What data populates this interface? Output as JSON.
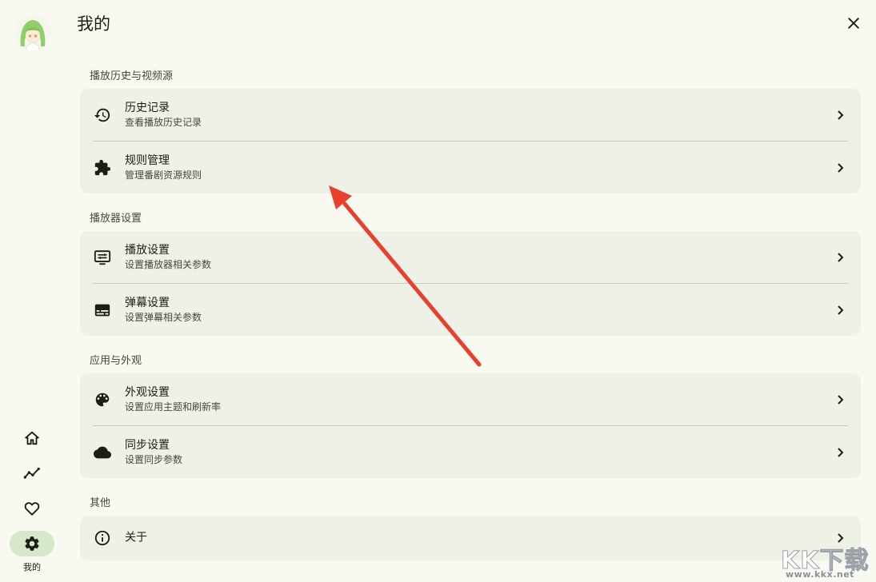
{
  "page_title": "我的",
  "nav": {
    "items": [
      {
        "icon": "home-icon"
      },
      {
        "icon": "trending-icon"
      },
      {
        "icon": "heart-icon"
      },
      {
        "icon": "gear-icon",
        "label": "我的",
        "active": true
      }
    ]
  },
  "sections": [
    {
      "title": "播放历史与视频源",
      "items": [
        {
          "title": "历史记录",
          "subtitle": "查看播放历史记录",
          "icon": "history-icon"
        },
        {
          "title": "规则管理",
          "subtitle": "管理番剧资源规则",
          "icon": "puzzle-icon"
        }
      ]
    },
    {
      "title": "播放器设置",
      "items": [
        {
          "title": "播放设置",
          "subtitle": "设置播放器相关参数",
          "icon": "monitor-settings-icon"
        },
        {
          "title": "弹幕设置",
          "subtitle": "设置弹幕相关参数",
          "icon": "subtitles-icon"
        }
      ]
    },
    {
      "title": "应用与外观",
      "items": [
        {
          "title": "外观设置",
          "subtitle": "设置应用主题和刷新率",
          "icon": "palette-icon"
        },
        {
          "title": "同步设置",
          "subtitle": "设置同步参数",
          "icon": "cloud-icon"
        }
      ]
    },
    {
      "title": "其他",
      "items": [
        {
          "title": "关于",
          "icon": "info-icon"
        }
      ]
    }
  ],
  "watermark": {
    "logo": "KK下载",
    "url": "www.kkx.net"
  },
  "colors": {
    "background": "#f8faf1",
    "card": "#eef1e6",
    "nav_active": "#d6e8c7",
    "annotation_arrow": "#e8402d"
  }
}
